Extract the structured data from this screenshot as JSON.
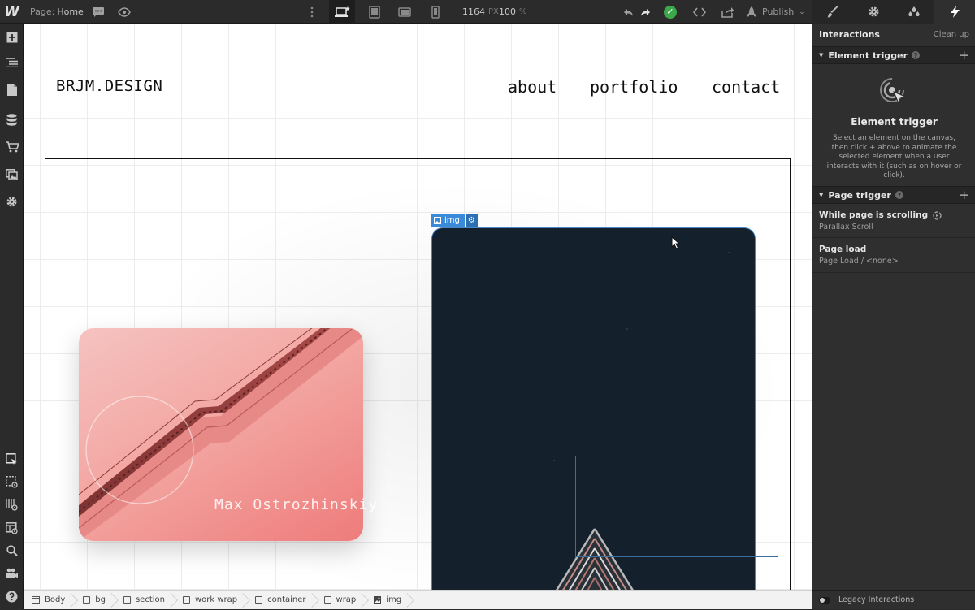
{
  "topbar": {
    "page_label": "Page:",
    "page_name": "Home",
    "width_value": "1164",
    "width_unit": "PX",
    "zoom_value": "100",
    "zoom_unit": "%",
    "publish_label": "Publish"
  },
  "canvas": {
    "brand": "BRJM.DESIGN",
    "nav": [
      "about",
      "portfolio",
      "contact"
    ],
    "caption": "Max Ostrozhinskiy",
    "selected_element_label": "img"
  },
  "breadcrumbs": [
    "Body",
    "bg",
    "section",
    "work wrap",
    "container",
    "wrap",
    "img"
  ],
  "panel": {
    "title": "Interactions",
    "cleanup": "Clean up",
    "element_trigger_header": "Element trigger",
    "element_trigger_title": "Element trigger",
    "element_trigger_desc": "Select an element on the canvas, then click + above to animate the selected element when a user interacts with it (such as on hover or click).",
    "page_trigger_header": "Page trigger",
    "page_triggers": [
      {
        "title": "While page is scrolling",
        "sub": "Parallax Scroll"
      },
      {
        "title": "Page load",
        "sub": "Page Load / <none>"
      }
    ],
    "legacy": "Legacy Interactions"
  },
  "colors": {
    "selection_blue": "#3b8ad9",
    "publish_check": "#3da84a",
    "pink_card": "#f3a7a3",
    "dark_card": "#14202b"
  }
}
